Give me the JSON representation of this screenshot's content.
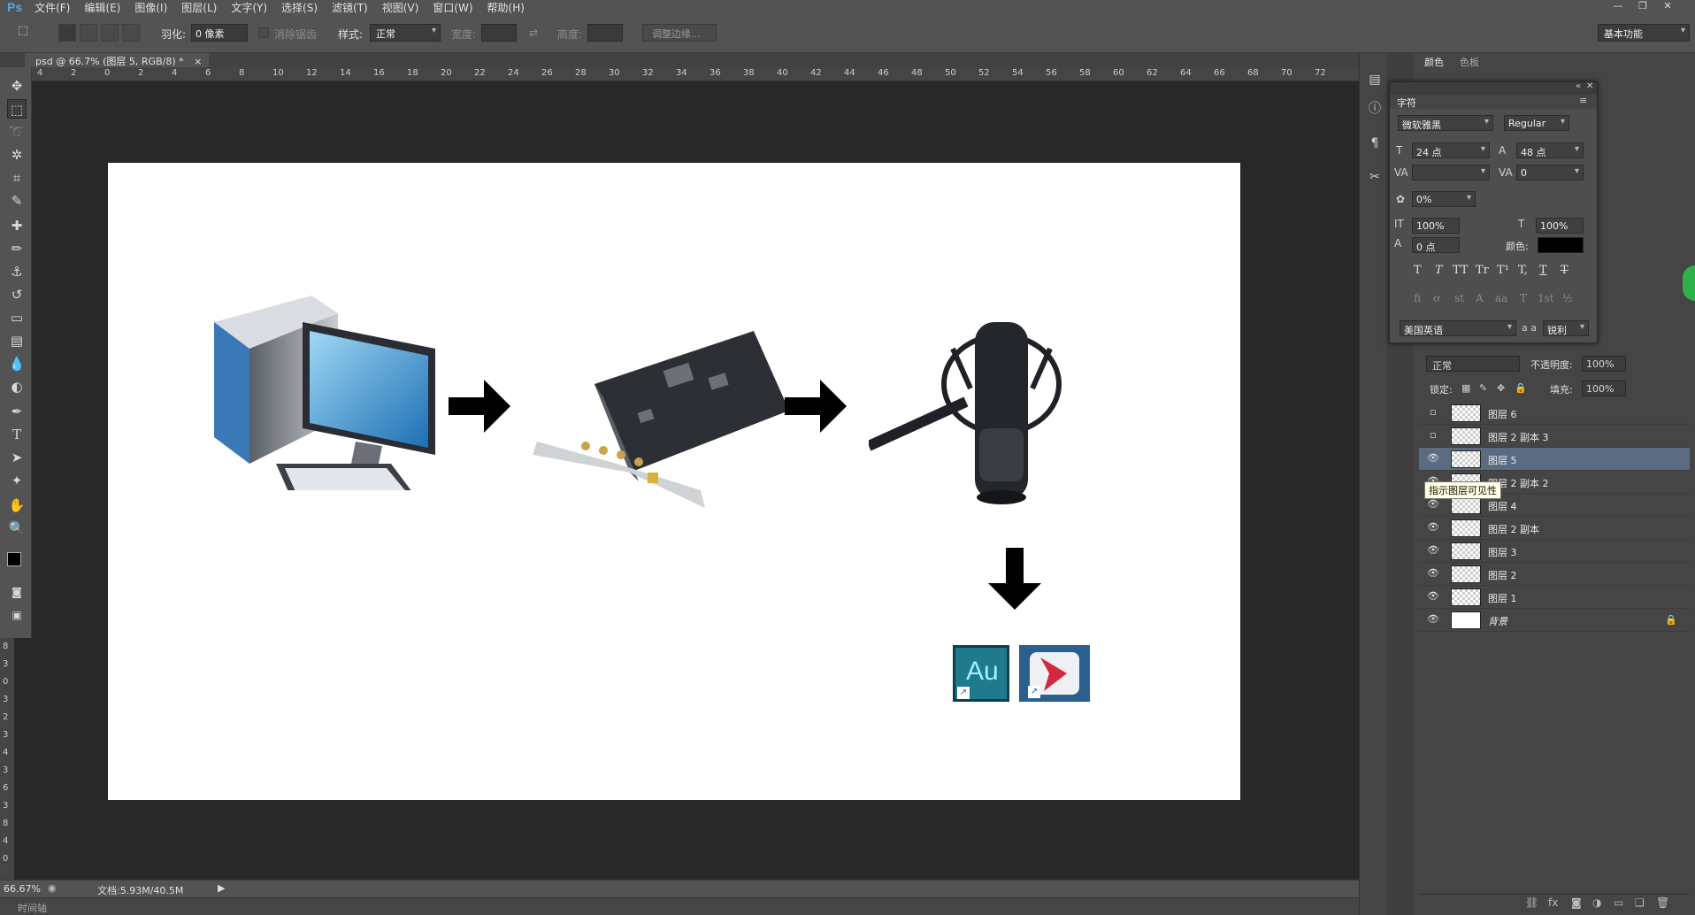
{
  "app": {
    "logo": "Ps",
    "menu": [
      "文件(F)",
      "编辑(E)",
      "图像(I)",
      "图层(L)",
      "文字(Y)",
      "选择(S)",
      "滤镜(T)",
      "视图(V)",
      "窗口(W)",
      "帮助(H)"
    ]
  },
  "options_bar": {
    "feather_label": "羽化:",
    "feather_value": "0 像素",
    "antialias_label": "消除锯齿",
    "style_label": "样式:",
    "style_value": "正常",
    "width_label": "宽度:",
    "height_label": "高度:",
    "refine_edge": "调整边缘...",
    "workspace": "基本功能"
  },
  "document_tab": {
    "title": "psd @ 66.7% (图层 5, RGB/8) *",
    "close": "×"
  },
  "ruler_ticks": [
    "4",
    "2",
    "0",
    "2",
    "4",
    "6",
    "8",
    "10",
    "12",
    "14",
    "16",
    "18",
    "20",
    "22",
    "24",
    "26",
    "28",
    "30",
    "32",
    "34",
    "36",
    "38",
    "40",
    "42",
    "44",
    "46",
    "48",
    "50",
    "52",
    "54",
    "56",
    "58",
    "60",
    "62",
    "64",
    "66",
    "68",
    "70",
    "72"
  ],
  "ruler_left_ticks": [
    "8",
    "3",
    "0",
    "3",
    "2",
    "3",
    "4",
    "3",
    "6",
    "3",
    "8",
    "4",
    "0"
  ],
  "canvas": {
    "app_icon_au": "Au"
  },
  "status": {
    "zoom": "66.67%",
    "doc_size": "文档:5.93M/40.5M",
    "timeline": "时间轴"
  },
  "right_tabs": {
    "color": "颜色",
    "swatches": "色板"
  },
  "character_panel": {
    "title": "字符",
    "font_family": "微软雅黑",
    "font_style": "Regular",
    "font_size": "24 点",
    "leading": "48 点",
    "kerning": "",
    "tracking": "0",
    "tsume": "0%",
    "vertical_scale": "100%",
    "horizontal_scale": "100%",
    "baseline_shift": "0 点",
    "color_label": "颜色:",
    "language": "美国英语",
    "aa_label": "a a",
    "antialias": "锐利",
    "type_buttons": [
      "T",
      "T",
      "TT",
      "Tr",
      "T¹",
      "T,",
      "T",
      "T"
    ],
    "opentype_buttons": [
      "fi",
      "ơ",
      "st",
      "A",
      "aa",
      "T",
      "1st",
      "½"
    ]
  },
  "layers": {
    "blend_mode": "正常",
    "opacity_label": "不透明度:",
    "opacity": "100%",
    "lock_label": "锁定:",
    "fill_label": "填充:",
    "fill": "100%",
    "tooltip": "指示图层可见性",
    "rows": [
      {
        "name": "图层 6",
        "visible": false
      },
      {
        "name": "图层 2 副本 3",
        "visible": false
      },
      {
        "name": "图层 5",
        "visible": true,
        "selected": true
      },
      {
        "name": "图层 2 副本 2",
        "visible": true
      },
      {
        "name": "图层 4",
        "visible": true
      },
      {
        "name": "图层 2 副本",
        "visible": true
      },
      {
        "name": "图层 3",
        "visible": true
      },
      {
        "name": "图层 2",
        "visible": true
      },
      {
        "name": "图层 1",
        "visible": true
      },
      {
        "name": "背景",
        "visible": true,
        "locked": true
      }
    ]
  },
  "colors": {
    "ui_dark": "#282828",
    "ui_panel": "#535353",
    "selection": "#5b6b82",
    "au_bg": "#1e7a8c",
    "au_text": "#9ff0ff",
    "red_app_bg": "#2a5f8e"
  }
}
